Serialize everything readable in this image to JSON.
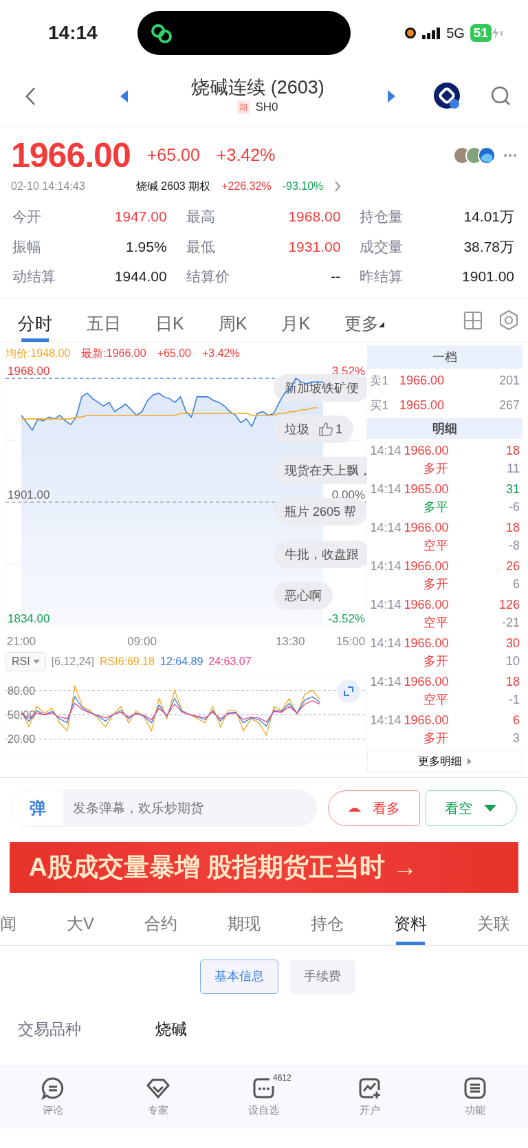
{
  "status_bar": {
    "time": "14:14",
    "network": "5G",
    "battery": "51"
  },
  "header": {
    "title": "烧碱连续 (2603)",
    "badge": "期",
    "code": "SH0"
  },
  "quote": {
    "price": "1966.00",
    "change": "+65.00",
    "change_pct": "+3.42%",
    "color": "#f23c3c",
    "datetime": "02-10 14:14:43",
    "option_label": "烧碱 2603 期权",
    "option_up": "+226.32%",
    "option_down": "-93.10%"
  },
  "stats": [
    {
      "label": "今开",
      "value": "1947.00",
      "color": "#f23c3c"
    },
    {
      "label": "最高",
      "value": "1968.00",
      "color": "#f23c3c"
    },
    {
      "label": "持仓量",
      "value": "14.01万",
      "color": "#222222"
    },
    {
      "label": "振幅",
      "value": "1.95%",
      "color": "#222222"
    },
    {
      "label": "最低",
      "value": "1931.00",
      "color": "#f23c3c"
    },
    {
      "label": "成交量",
      "value": "38.78万",
      "color": "#222222"
    },
    {
      "label": "动结算",
      "value": "1944.00",
      "color": "#222222"
    },
    {
      "label": "结算价",
      "value": "--",
      "color": "#222222"
    },
    {
      "label": "昨结算",
      "value": "1901.00",
      "color": "#222222"
    }
  ],
  "chart_tabs": [
    {
      "label": "分时",
      "selected": true
    },
    {
      "label": "五日",
      "selected": false
    },
    {
      "label": "日K",
      "selected": false
    },
    {
      "label": "周K",
      "selected": false
    },
    {
      "label": "月K",
      "selected": false
    },
    {
      "label": "更多",
      "selected": false
    }
  ],
  "intraday": {
    "legend": [
      {
        "text": "均价:1948.00",
        "color": "#f5a623"
      },
      {
        "text": "最新:1966.00",
        "color": "#f23c3c"
      },
      {
        "text": "+65.00",
        "color": "#f23c3c"
      },
      {
        "text": "+3.42%",
        "color": "#f23c3c"
      }
    ],
    "right_axis_labels": [
      {
        "text": "3.52%",
        "color": "#f23c3c"
      },
      {
        "text": "0.00%",
        "color": "#666666"
      },
      {
        "text": "-3.52%",
        "color": "#14a052"
      }
    ],
    "chart_data": {
      "type": "line",
      "ylim": [
        1834,
        1968
      ],
      "ref_lines": [
        {
          "axis": "y",
          "value": 1901
        }
      ],
      "categories": [
        "21:00",
        null,
        null,
        null,
        null,
        null,
        null,
        null,
        null,
        null,
        null,
        null,
        null,
        null,
        null,
        null,
        null,
        null,
        null,
        null,
        null,
        null,
        "09:00",
        null,
        null,
        null,
        null,
        null,
        null,
        null,
        null,
        null,
        null,
        null,
        null,
        null,
        null,
        null,
        null,
        null,
        null,
        null,
        null,
        null,
        null,
        null,
        null,
        null,
        null,
        "13:30",
        null,
        null,
        null,
        null,
        null,
        null,
        null,
        null,
        null,
        null,
        "15:00"
      ],
      "yticks": [
        {
          "value": 1968,
          "label": "1968.00"
        },
        {
          "value": 1901,
          "label": "1901.00"
        },
        {
          "value": 1834,
          "label": "1834.00"
        }
      ],
      "series": [
        {
          "color": "#3b7ddd",
          "values": [
            1948,
            1944,
            1940,
            1946,
            1945,
            1947,
            1946,
            1948,
            1945,
            1943,
            1947,
            1958,
            1960,
            1957,
            1955,
            1953,
            1955,
            1950,
            1952,
            1954,
            1951,
            1948,
            1950,
            1956,
            1959,
            1960,
            1958,
            1957,
            1955,
            1958,
            1950,
            1947,
            1958,
            1958,
            1958,
            1956,
            1955,
            1953,
            1950,
            1948,
            1944,
            1946,
            1942,
            1949,
            1950,
            1948,
            1949,
            1955,
            1960,
            1962,
            1968,
            1966,
            1965,
            1966,
            1966,
            1966,
            null,
            null,
            null,
            null,
            null
          ]
        },
        {
          "color": "#f5a623",
          "values": [
            1946,
            1946,
            1946,
            1946,
            1946,
            1946,
            1946,
            1946,
            1946,
            1946,
            1947,
            1947,
            1948,
            1948,
            1948,
            1948,
            1948,
            1948,
            1948,
            1948,
            1948,
            1948,
            1948,
            1948,
            1948,
            1948,
            1948,
            1948,
            1948,
            1949,
            1949,
            1949,
            1949,
            1949,
            1949,
            1949,
            1949,
            1949,
            1949,
            1949,
            1949,
            1949,
            1948,
            1948,
            1948,
            1948,
            1948,
            1949,
            1949,
            1950,
            1950,
            1951,
            1951,
            1952,
            1952,
            null,
            null,
            null,
            null,
            null,
            null
          ]
        }
      ]
    },
    "comments": [
      {
        "text": "新加坡铁矿便"
      },
      {
        "text": "垃圾",
        "likes": "1"
      },
      {
        "text": "现货在天上飘，"
      },
      {
        "text": "瓶片 2605 帮"
      },
      {
        "text": "牛批，收盘跟"
      },
      {
        "text": "恶心啊"
      }
    ]
  },
  "rsi": {
    "selector": "RSI",
    "params": "[6,12,24]",
    "legend": [
      {
        "text": "RSI6:69.18",
        "color": "#f5a623"
      },
      {
        "text": "12:64.89",
        "color": "#3b7ddd"
      },
      {
        "text": "24:63.07",
        "color": "#e8458b"
      }
    ],
    "chart_data": {
      "type": "line",
      "grid": true,
      "ylim": [
        0,
        100
      ],
      "categories": [
        null,
        null,
        null,
        null,
        null,
        null,
        null,
        null,
        null,
        null,
        null,
        null,
        null,
        null,
        null,
        null,
        null,
        null,
        null,
        null,
        null,
        null,
        null,
        null,
        null,
        null,
        null,
        null,
        null,
        null,
        null,
        null,
        null,
        null,
        null,
        null,
        null,
        null,
        null,
        null,
        null,
        null,
        null,
        null
      ],
      "yticks": [
        {
          "value": 80,
          "label": "80.00"
        },
        {
          "value": 50,
          "label": "50.00"
        },
        {
          "value": 20,
          "label": "20.00"
        }
      ],
      "series": [
        {
          "color": "#f5a623",
          "values": [
            55,
            35,
            60,
            52,
            58,
            40,
            30,
            85,
            60,
            55,
            45,
            35,
            50,
            60,
            40,
            55,
            48,
            30,
            70,
            45,
            80,
            55,
            50,
            45,
            40,
            60,
            35,
            55,
            55,
            30,
            45,
            40,
            25,
            60,
            55,
            70,
            50,
            75,
            80,
            69,
            null,
            null,
            null,
            null
          ]
        },
        {
          "color": "#3b7ddd",
          "values": [
            52,
            42,
            55,
            50,
            54,
            45,
            40,
            72,
            58,
            53,
            48,
            42,
            50,
            55,
            45,
            52,
            48,
            40,
            62,
            48,
            70,
            54,
            50,
            47,
            44,
            55,
            42,
            52,
            53,
            40,
            46,
            44,
            36,
            56,
            54,
            64,
            52,
            68,
            72,
            65,
            null,
            null,
            null,
            null
          ]
        },
        {
          "color": "#e8458b",
          "values": [
            51,
            46,
            52,
            50,
            52,
            47,
            45,
            64,
            56,
            52,
            49,
            46,
            50,
            53,
            47,
            51,
            49,
            44,
            58,
            49,
            63,
            53,
            50,
            48,
            46,
            53,
            45,
            51,
            52,
            44,
            47,
            46,
            41,
            54,
            53,
            60,
            52,
            63,
            67,
            63,
            null,
            null,
            null,
            null
          ]
        }
      ]
    }
  },
  "order_book": {
    "title": "一档",
    "levels": [
      {
        "label": "卖1",
        "price": "1966.00",
        "volume": "201"
      },
      {
        "label": "买1",
        "price": "1965.00",
        "volume": "267"
      }
    ],
    "detail_title": "明细",
    "trades": [
      {
        "time": "14:14",
        "price": "1966.00",
        "volume": "18",
        "type": "多开",
        "oi_change": "11",
        "color": "#f23c3c"
      },
      {
        "time": "14:14",
        "price": "1965.00",
        "volume": "31",
        "type": "多平",
        "oi_change": "-6",
        "color": "#14a052"
      },
      {
        "time": "14:14",
        "price": "1966.00",
        "volume": "18",
        "type": "空平",
        "oi_change": "-8",
        "color": "#f23c3c"
      },
      {
        "time": "14:14",
        "price": "1966.00",
        "volume": "26",
        "type": "多开",
        "oi_change": "6",
        "color": "#f23c3c"
      },
      {
        "time": "14:14",
        "price": "1966.00",
        "volume": "126",
        "type": "空平",
        "oi_change": "-21",
        "color": "#f23c3c"
      },
      {
        "time": "14:14",
        "price": "1966.00",
        "volume": "30",
        "type": "多开",
        "oi_change": "10",
        "color": "#f23c3c"
      },
      {
        "time": "14:14",
        "price": "1966.00",
        "volume": "18",
        "type": "空平",
        "oi_change": "-1",
        "color": "#f23c3c"
      },
      {
        "time": "14:14",
        "price": "1966.00",
        "volume": "6",
        "type": "多开",
        "oi_change": "3",
        "color": "#f23c3c"
      }
    ],
    "more": "更多明细"
  },
  "danmaku": {
    "logo": "弹",
    "placeholder": "发条弹幕，欢乐炒期货",
    "bull": "看多",
    "bear": "看空"
  },
  "banner": {
    "text": "A股成交量暴增 股指期货正当时 →"
  },
  "section_tabs": [
    {
      "label": "闻",
      "selected": false
    },
    {
      "label": "大V",
      "selected": false
    },
    {
      "label": "合约",
      "selected": false
    },
    {
      "label": "期现",
      "selected": false
    },
    {
      "label": "持仓",
      "selected": false
    },
    {
      "label": "资料",
      "selected": true
    },
    {
      "label": "关联",
      "selected": false
    }
  ],
  "sub_tabs": [
    {
      "label": "基本信息",
      "selected": true
    },
    {
      "label": "手续费",
      "selected": false
    }
  ],
  "info_rows": [
    {
      "label": "交易品种",
      "value": "烧碱"
    }
  ],
  "bottom_nav": [
    {
      "label": "评论",
      "kind": "comment"
    },
    {
      "label": "专家",
      "kind": "expert"
    },
    {
      "label": "设自选",
      "kind": "watch",
      "badge": "4612"
    },
    {
      "label": "开户",
      "kind": "account"
    },
    {
      "label": "功能",
      "kind": "menu"
    }
  ]
}
